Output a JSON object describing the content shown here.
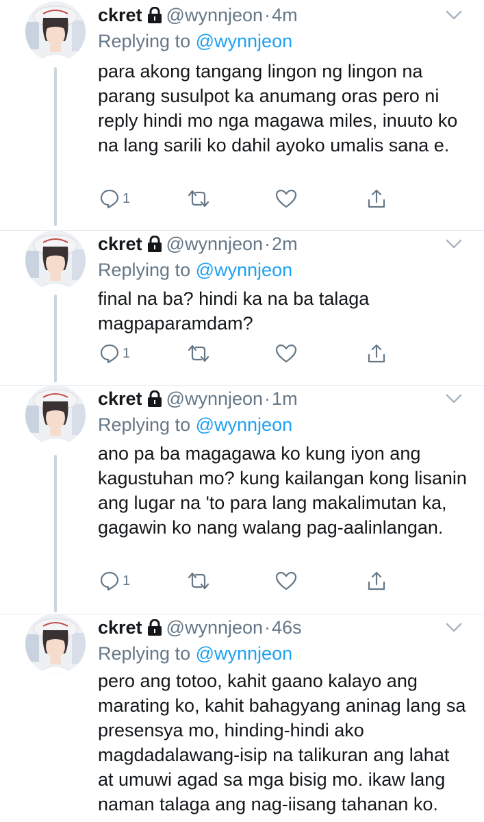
{
  "tweets": [
    {
      "name": "ckret",
      "handle": "@wynnjeon",
      "dot": "·",
      "time": "4m",
      "reply_prefix": "Replying to",
      "reply_to": "@wynnjeon",
      "text": "para akong tangang lingon ng lingon na parang susulpot ka anumang oras pero ni reply hindi mo nga magawa miles, inuuto ko na lang sarili ko dahil ayoko umalis sana e.",
      "reply_count": "1"
    },
    {
      "name": "ckret",
      "handle": "@wynnjeon",
      "dot": "·",
      "time": "2m",
      "reply_prefix": "Replying to",
      "reply_to": "@wynnjeon",
      "text": "final na ba? hindi ka na ba talaga magpaparamdam?",
      "reply_count": "1"
    },
    {
      "name": "ckret",
      "handle": "@wynnjeon",
      "dot": "·",
      "time": "1m",
      "reply_prefix": "Replying to",
      "reply_to": "@wynnjeon",
      "text": "ano pa ba magagawa ko kung iyon ang kagustuhan mo? kung kailangan kong lisanin ang lugar na 'to para lang makalimutan ka, gagawin ko nang walang pag-aalinlangan.",
      "reply_count": "1"
    },
    {
      "name": "ckret",
      "handle": "@wynnjeon",
      "dot": "·",
      "time": "46s",
      "reply_prefix": "Replying to",
      "reply_to": "@wynnjeon",
      "text": "pero ang totoo, kahit gaano kalayo ang marating ko, kahit bahagyang aninag lang sa presensya mo, hinding-hindi ako magdadalawang-isip na talikuran ang lahat at umuwi agad sa mga bisig mo. ikaw lang naman talaga ang nag-iisang tahanan ko.",
      "reply_count": ""
    }
  ],
  "colors": {
    "text": "#14171a",
    "secondary": "#657786",
    "link": "#1da1f2",
    "thread_line": "#ccd6dd",
    "separator": "#e6ecf0"
  },
  "icons": [
    "lock-icon",
    "chevron-down-icon",
    "reply-icon",
    "retweet-icon",
    "like-icon",
    "share-icon"
  ]
}
